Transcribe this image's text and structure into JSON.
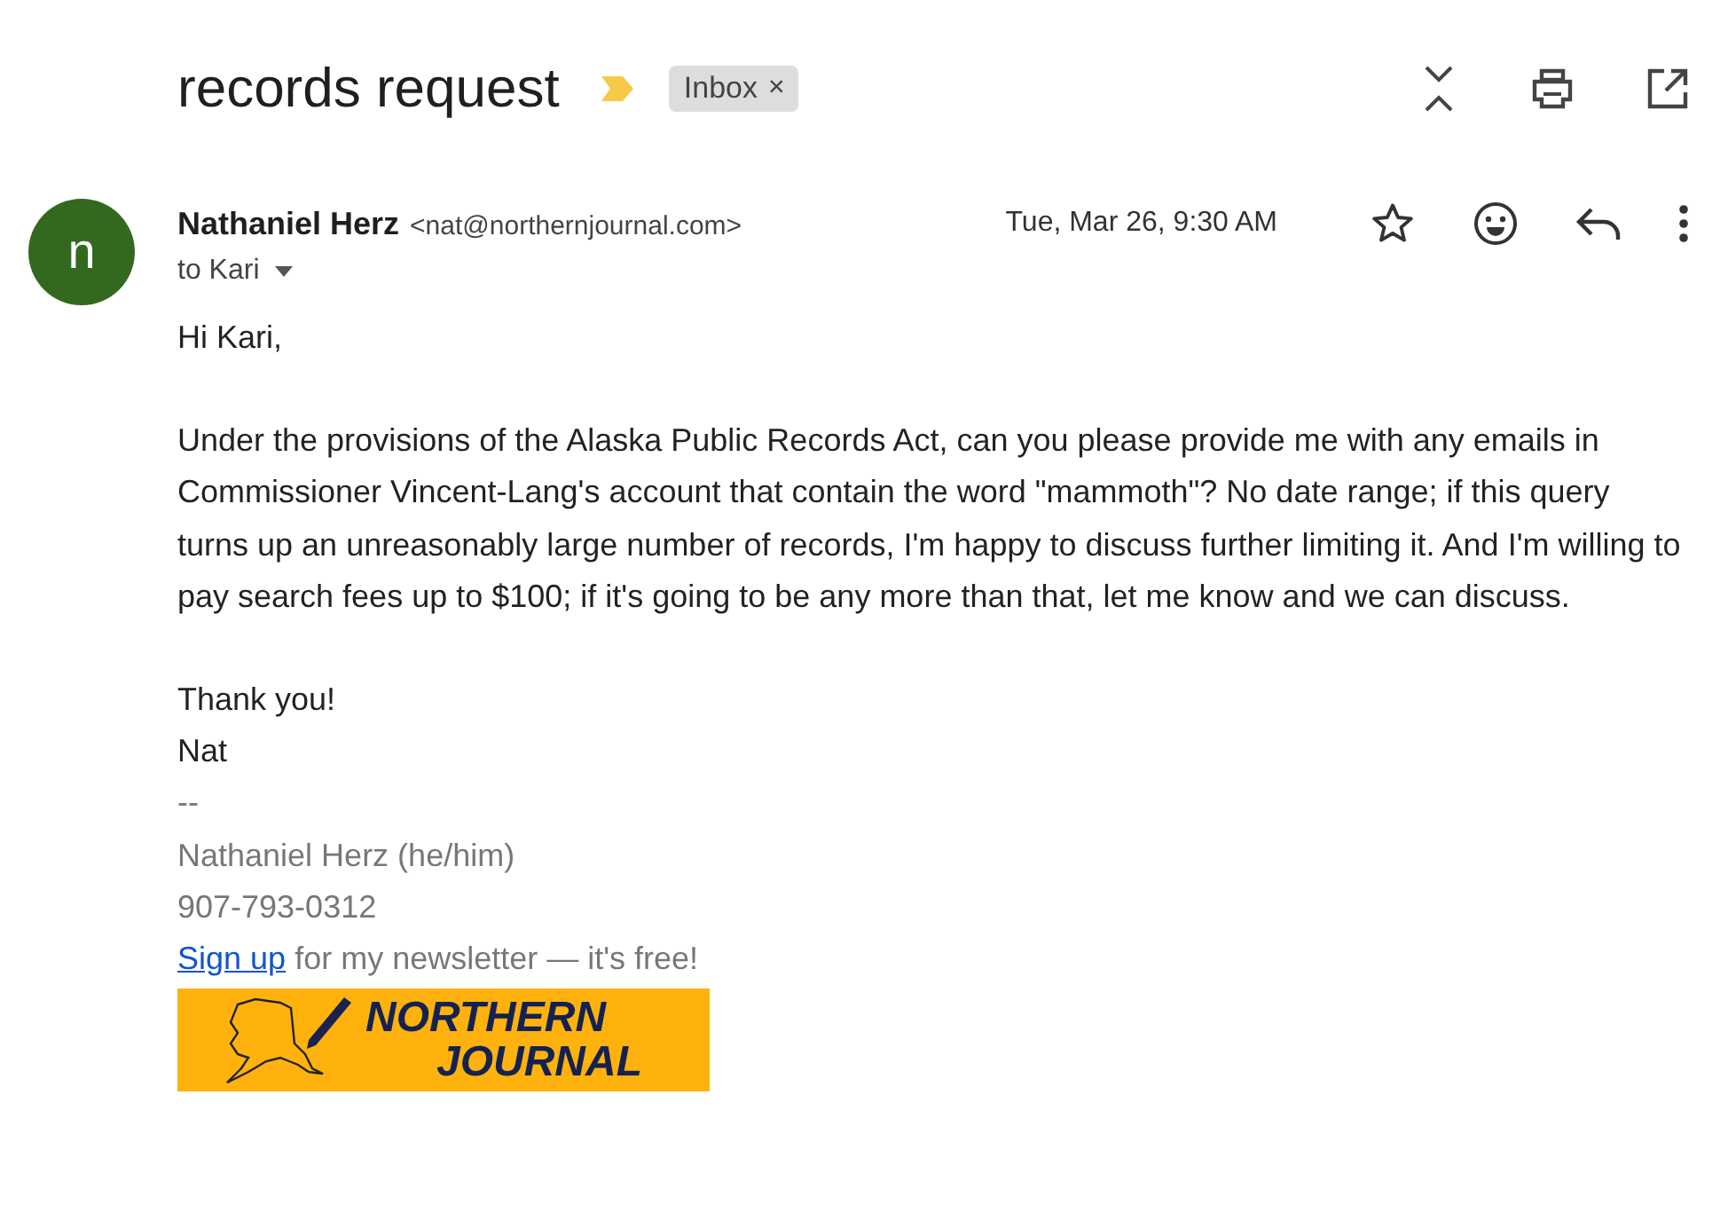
{
  "subject": "records request",
  "important": true,
  "labels": [
    {
      "text": "Inbox",
      "remove": "×"
    }
  ],
  "sender": {
    "name": "Nathaniel Herz",
    "email": "<nat@northernjournal.com>",
    "avatar": "n",
    "date": "Tue, Mar 26, 9:30 AM",
    "to": "to Kari",
    "starred": false
  },
  "body": [
    "Hi Kari,",
    "Under the provisions of the Alaska Public Records Act, can you please provide me with any emails in Commissioner Vincent-Lang's account that contain the word \"mammoth\"? No date range; if this query turns up an unreasonably large number of records, I'm happy to discuss further limiting it. And I'm willing to pay search fees up to $100; if it's going to be any more than that, let me know and we can discuss."
  ],
  "closing": [
    "Thank you!",
    "Nat"
  ],
  "signature": {
    "lines": [
      "--",
      "Nathaniel Herz (he/him)",
      "907-793-0312"
    ],
    "link": "Sign up",
    "link_rest": " for my newsletter — it's free!",
    "logo": [
      "NORTHERN",
      "JOURNAL"
    ]
  }
}
